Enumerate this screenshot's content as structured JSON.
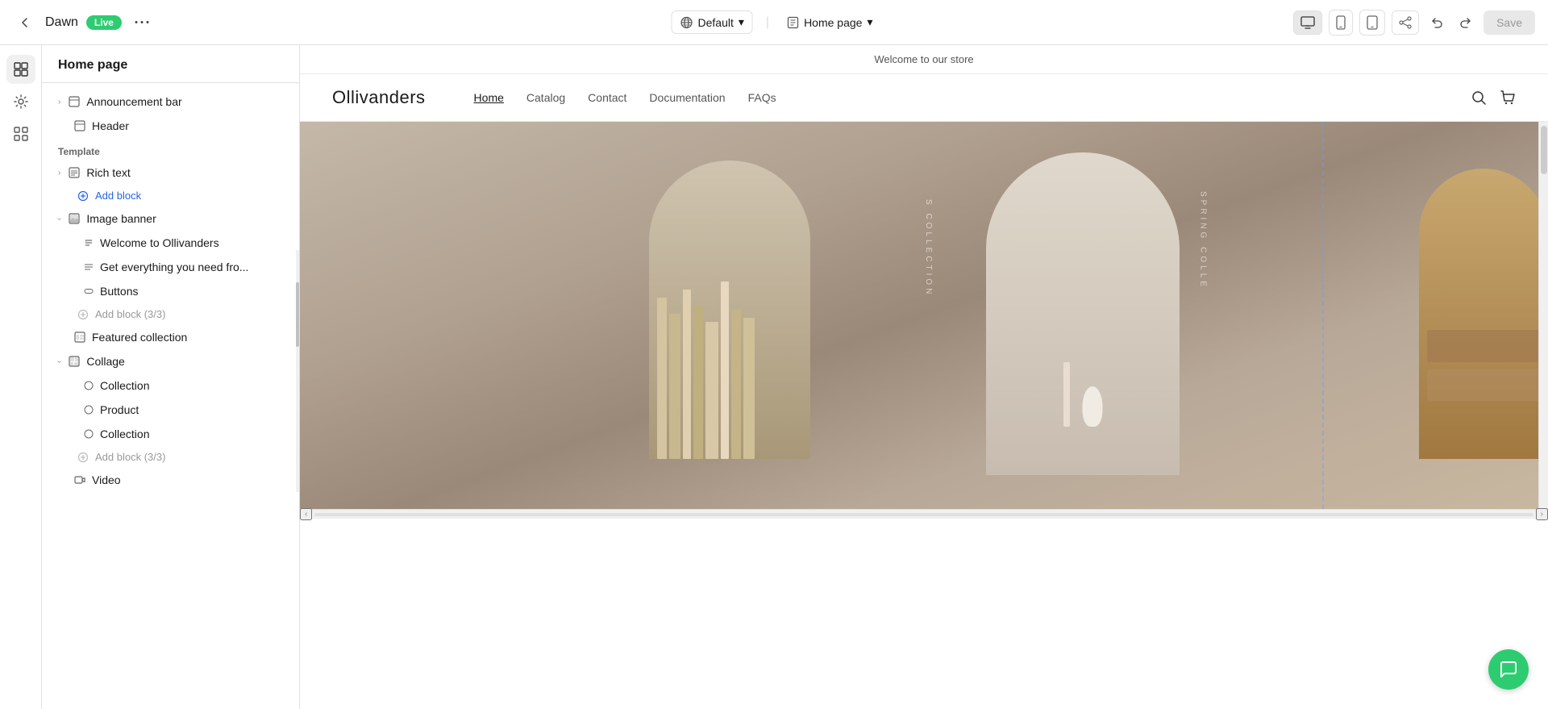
{
  "topbar": {
    "back_icon": "←",
    "app_name": "Dawn",
    "live_label": "Live",
    "more_icon": "•••",
    "default_label": "Default",
    "chevron": "▾",
    "home_icon": "🏠",
    "page_label": "Home page",
    "save_label": "Save"
  },
  "sidebar": {
    "title": "Home page",
    "items": [
      {
        "id": "announcement-bar",
        "label": "Announcement bar",
        "icon": "layout",
        "chevron": "›",
        "indent": 0
      },
      {
        "id": "header",
        "label": "Header",
        "icon": "layout",
        "indent": 0
      },
      {
        "id": "template-label",
        "label": "Template",
        "type": "section-label"
      },
      {
        "id": "rich-text",
        "label": "Rich text",
        "icon": "layout",
        "chevron": "‹",
        "indent": 0,
        "expanded": false
      },
      {
        "id": "add-block",
        "label": "Add block",
        "type": "add-block",
        "indent": 1
      },
      {
        "id": "image-banner",
        "label": "Image banner",
        "icon": "image",
        "chevron": "‹",
        "indent": 0,
        "expanded": true
      },
      {
        "id": "welcome-text",
        "label": "Welcome to Ollivanders",
        "icon": "text",
        "indent": 1
      },
      {
        "id": "get-everything",
        "label": "Get everything you need fro...",
        "icon": "list",
        "indent": 1
      },
      {
        "id": "buttons",
        "label": "Buttons",
        "icon": "layout",
        "indent": 1
      },
      {
        "id": "add-block-3-3",
        "label": "Add block (3/3)",
        "type": "add-block-disabled",
        "indent": 1
      },
      {
        "id": "featured-collection",
        "label": "Featured collection",
        "icon": "layout",
        "indent": 0
      },
      {
        "id": "collage",
        "label": "Collage",
        "icon": "layout",
        "chevron": "‹",
        "indent": 0,
        "expanded": true
      },
      {
        "id": "collection-1",
        "label": "Collection",
        "icon": "tag",
        "indent": 1
      },
      {
        "id": "product",
        "label": "Product",
        "icon": "tag",
        "indent": 1
      },
      {
        "id": "collection-2",
        "label": "Collection",
        "icon": "tag",
        "indent": 1
      },
      {
        "id": "add-block-collage",
        "label": "Add block (3/3)",
        "type": "add-block-disabled",
        "indent": 1
      },
      {
        "id": "video",
        "label": "Video",
        "icon": "layout",
        "indent": 0
      }
    ]
  },
  "preview": {
    "announcement": "Welcome to our store",
    "logo": "Ollivanders",
    "nav_links": [
      {
        "label": "Home",
        "active": true
      },
      {
        "label": "Catalog",
        "active": false
      },
      {
        "label": "Contact",
        "active": false
      },
      {
        "label": "Documentation",
        "active": false
      },
      {
        "label": "FAQs",
        "active": false
      }
    ],
    "hero": {
      "vertical_text_1": "S COLLECTION",
      "vertical_text_2": "SPRING COLLE"
    }
  },
  "icons": {
    "back": "←",
    "globe": "🌐",
    "home": "⌂",
    "desktop": "🖥",
    "mobile": "📱",
    "tablet": "⬜",
    "share": "⤴",
    "undo": "↩",
    "redo": "↪",
    "search": "🔍",
    "cart": "🛒",
    "chat": "💬",
    "chevron_down": "▾",
    "chevron_right": "›",
    "plus": "+",
    "sections": "⊞",
    "apps": "⊞",
    "pages": "☰",
    "layout_icon": "▤",
    "text_icon": "T",
    "list_icon": "≡",
    "image_icon": "⬜",
    "tag_icon": "◯"
  }
}
